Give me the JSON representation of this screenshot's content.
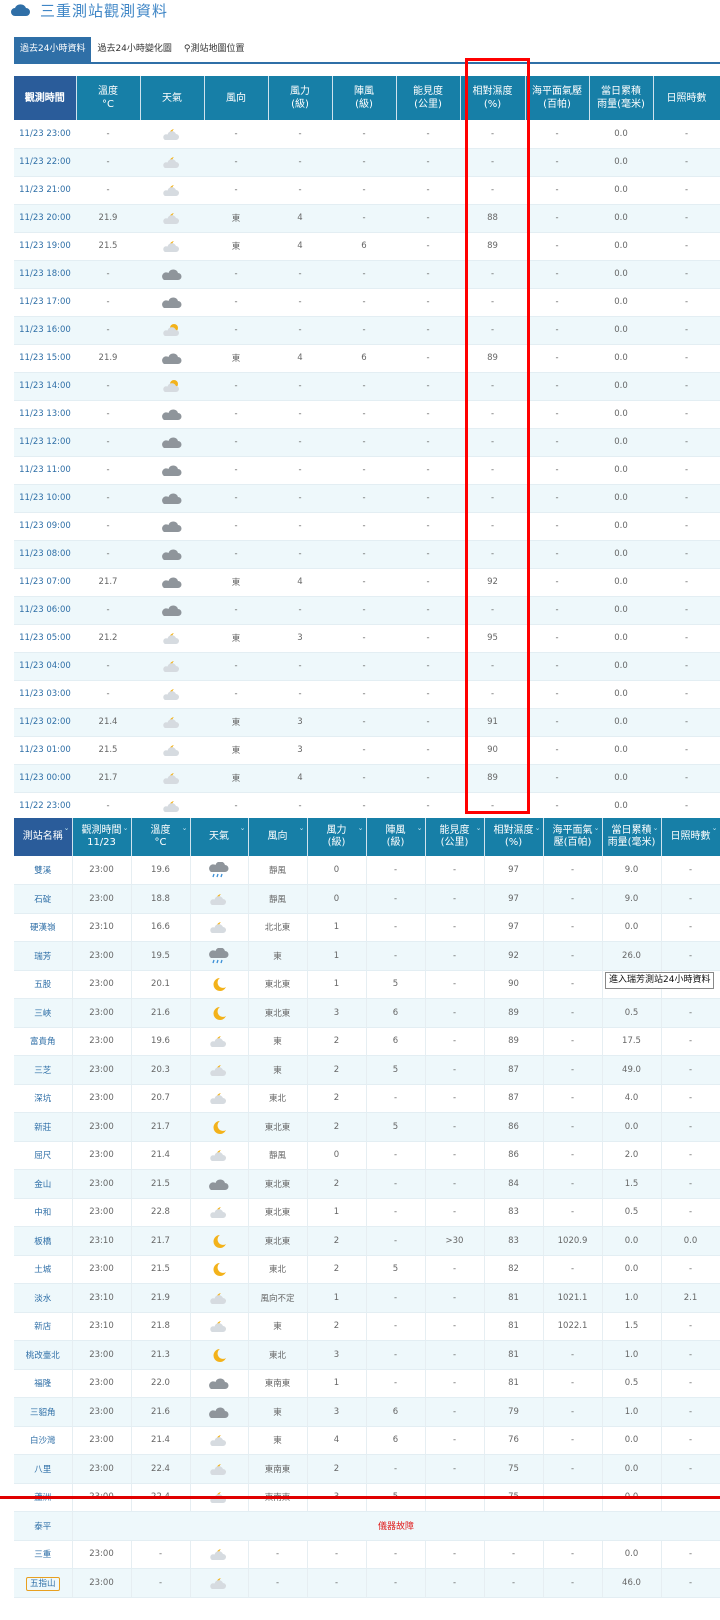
{
  "page": {
    "title": "三重測站觀測資料",
    "tabs": [
      "過去24小時資料",
      "過去24小時變化圖",
      "測站地圖位置"
    ]
  },
  "hourly": {
    "headers": [
      "觀測時間",
      "溫度\n°C",
      "天氣",
      "風向",
      "風力\n(級)",
      "陣風\n(級)",
      "能見度\n(公里)",
      "相對濕度\n(%)",
      "海平面氣壓\n(百帕)",
      "當日累積\n雨量(毫米)",
      "日照時數"
    ],
    "rows": [
      [
        "11/23 23:00",
        "-",
        "partly-cloudy-night",
        "-",
        "-",
        "-",
        "-",
        "-",
        "-",
        "0.0",
        "-"
      ],
      [
        "11/23 22:00",
        "-",
        "partly-cloudy-night",
        "-",
        "-",
        "-",
        "-",
        "-",
        "-",
        "0.0",
        "-"
      ],
      [
        "11/23 21:00",
        "-",
        "partly-cloudy-night",
        "-",
        "-",
        "-",
        "-",
        "-",
        "-",
        "0.0",
        "-"
      ],
      [
        "11/23 20:00",
        "21.9",
        "partly-cloudy-night",
        "東",
        "4",
        "-",
        "-",
        "88",
        "-",
        "0.0",
        "-"
      ],
      [
        "11/23 19:00",
        "21.5",
        "partly-cloudy-night",
        "東",
        "4",
        "6",
        "-",
        "89",
        "-",
        "0.0",
        "-"
      ],
      [
        "11/23 18:00",
        "-",
        "cloudy",
        "-",
        "-",
        "-",
        "-",
        "-",
        "-",
        "0.0",
        "-"
      ],
      [
        "11/23 17:00",
        "-",
        "cloudy",
        "-",
        "-",
        "-",
        "-",
        "-",
        "-",
        "0.0",
        "-"
      ],
      [
        "11/23 16:00",
        "-",
        "partly-cloudy-day",
        "-",
        "-",
        "-",
        "-",
        "-",
        "-",
        "0.0",
        "-"
      ],
      [
        "11/23 15:00",
        "21.9",
        "cloudy",
        "東",
        "4",
        "6",
        "-",
        "89",
        "-",
        "0.0",
        "-"
      ],
      [
        "11/23 14:00",
        "-",
        "partly-cloudy-day",
        "-",
        "-",
        "-",
        "-",
        "-",
        "-",
        "0.0",
        "-"
      ],
      [
        "11/23 13:00",
        "-",
        "cloudy",
        "-",
        "-",
        "-",
        "-",
        "-",
        "-",
        "0.0",
        "-"
      ],
      [
        "11/23 12:00",
        "-",
        "cloudy",
        "-",
        "-",
        "-",
        "-",
        "-",
        "-",
        "0.0",
        "-"
      ],
      [
        "11/23 11:00",
        "-",
        "cloudy",
        "-",
        "-",
        "-",
        "-",
        "-",
        "-",
        "0.0",
        "-"
      ],
      [
        "11/23 10:00",
        "-",
        "cloudy",
        "-",
        "-",
        "-",
        "-",
        "-",
        "-",
        "0.0",
        "-"
      ],
      [
        "11/23 09:00",
        "-",
        "cloudy",
        "-",
        "-",
        "-",
        "-",
        "-",
        "-",
        "0.0",
        "-"
      ],
      [
        "11/23 08:00",
        "-",
        "cloudy",
        "-",
        "-",
        "-",
        "-",
        "-",
        "-",
        "0.0",
        "-"
      ],
      [
        "11/23 07:00",
        "21.7",
        "cloudy",
        "東",
        "4",
        "-",
        "-",
        "92",
        "-",
        "0.0",
        "-"
      ],
      [
        "11/23 06:00",
        "-",
        "cloudy",
        "-",
        "-",
        "-",
        "-",
        "-",
        "-",
        "0.0",
        "-"
      ],
      [
        "11/23 05:00",
        "21.2",
        "partly-cloudy-night",
        "東",
        "3",
        "-",
        "-",
        "95",
        "-",
        "0.0",
        "-"
      ],
      [
        "11/23 04:00",
        "-",
        "partly-cloudy-night",
        "-",
        "-",
        "-",
        "-",
        "-",
        "-",
        "0.0",
        "-"
      ],
      [
        "11/23 03:00",
        "-",
        "partly-cloudy-night",
        "-",
        "-",
        "-",
        "-",
        "-",
        "-",
        "0.0",
        "-"
      ],
      [
        "11/23 02:00",
        "21.4",
        "partly-cloudy-night",
        "東",
        "3",
        "-",
        "-",
        "91",
        "-",
        "0.0",
        "-"
      ],
      [
        "11/23 01:00",
        "21.5",
        "partly-cloudy-night",
        "東",
        "3",
        "-",
        "-",
        "90",
        "-",
        "0.0",
        "-"
      ],
      [
        "11/23 00:00",
        "21.7",
        "partly-cloudy-night",
        "東",
        "4",
        "-",
        "-",
        "89",
        "-",
        "0.0",
        "-"
      ],
      [
        "11/22 23:00",
        "-",
        "partly-cloudy-night",
        "-",
        "-",
        "-",
        "-",
        "-",
        "-",
        "0.0",
        "-"
      ]
    ]
  },
  "stations": {
    "headers": [
      "測站名稱",
      "觀測時間\n11/23",
      "溫度\n°C",
      "天氣",
      "風向",
      "風力\n(級)",
      "陣風\n(級)",
      "能見度\n(公里)",
      "相對濕度\n(%)",
      "海平面氣\n壓(百帕)",
      "當日累積\n雨量(毫米)",
      "日照時數"
    ],
    "rows": [
      [
        "雙溪",
        "23:00",
        "19.6",
        "rain",
        "靜風",
        "0",
        "-",
        "-",
        "97",
        "-",
        "9.0",
        "-"
      ],
      [
        "石碇",
        "23:00",
        "18.8",
        "partly-cloudy-night",
        "靜風",
        "0",
        "-",
        "-",
        "97",
        "-",
        "9.0",
        "-"
      ],
      [
        "硬漢嶺",
        "23:10",
        "16.6",
        "partly-cloudy-night",
        "北北東",
        "1",
        "-",
        "-",
        "97",
        "-",
        "0.0",
        "-"
      ],
      [
        "瑞芳",
        "23:00",
        "19.5",
        "rain",
        "東",
        "1",
        "-",
        "-",
        "92",
        "-",
        "26.0",
        "-"
      ],
      [
        "五股",
        "23:00",
        "20.1",
        "moon",
        "東北東",
        "1",
        "5",
        "-",
        "90",
        "-",
        "",
        ""
      ],
      [
        "三峽",
        "23:00",
        "21.6",
        "moon",
        "東北東",
        "3",
        "6",
        "-",
        "89",
        "-",
        "0.5",
        "-"
      ],
      [
        "富貴角",
        "23:00",
        "19.6",
        "partly-cloudy-night",
        "東",
        "2",
        "6",
        "-",
        "89",
        "-",
        "17.5",
        "-"
      ],
      [
        "三芝",
        "23:00",
        "20.3",
        "partly-cloudy-night",
        "東",
        "2",
        "5",
        "-",
        "87",
        "-",
        "49.0",
        "-"
      ],
      [
        "深坑",
        "23:00",
        "20.7",
        "partly-cloudy-night",
        "東北",
        "2",
        "-",
        "-",
        "87",
        "-",
        "4.0",
        "-"
      ],
      [
        "新莊",
        "23:00",
        "21.7",
        "moon",
        "東北東",
        "2",
        "5",
        "-",
        "86",
        "-",
        "0.0",
        "-"
      ],
      [
        "屈尺",
        "23:00",
        "21.4",
        "partly-cloudy-night",
        "靜風",
        "0",
        "-",
        "-",
        "86",
        "-",
        "2.0",
        "-"
      ],
      [
        "金山",
        "23:00",
        "21.5",
        "cloudy",
        "東北東",
        "2",
        "-",
        "-",
        "84",
        "-",
        "1.5",
        "-"
      ],
      [
        "中和",
        "23:00",
        "22.8",
        "partly-cloudy-night",
        "東北東",
        "1",
        "-",
        "-",
        "83",
        "-",
        "0.5",
        "-"
      ],
      [
        "板橋",
        "23:10",
        "21.7",
        "moon",
        "東北東",
        "2",
        "-",
        ">30",
        "83",
        "1020.9",
        "0.0",
        "0.0"
      ],
      [
        "土城",
        "23:00",
        "21.5",
        "moon",
        "東北",
        "2",
        "5",
        "-",
        "82",
        "-",
        "0.0",
        "-"
      ],
      [
        "淡水",
        "23:10",
        "21.9",
        "partly-cloudy-night",
        "風向不定",
        "1",
        "-",
        "-",
        "81",
        "1021.1",
        "1.0",
        "2.1"
      ],
      [
        "新店",
        "23:10",
        "21.8",
        "partly-cloudy-night",
        "東",
        "2",
        "-",
        "-",
        "81",
        "1022.1",
        "1.5",
        "-"
      ],
      [
        "桃改臺北",
        "23:00",
        "21.3",
        "moon",
        "東北",
        "3",
        "-",
        "-",
        "81",
        "-",
        "1.0",
        "-"
      ],
      [
        "福隆",
        "23:00",
        "22.0",
        "cloudy",
        "東南東",
        "1",
        "-",
        "-",
        "81",
        "-",
        "0.5",
        "-"
      ],
      [
        "三貂角",
        "23:00",
        "21.6",
        "cloudy",
        "東",
        "3",
        "6",
        "-",
        "79",
        "-",
        "1.0",
        "-"
      ],
      [
        "白沙灣",
        "23:00",
        "21.4",
        "partly-cloudy-night",
        "東",
        "4",
        "6",
        "-",
        "76",
        "-",
        "0.0",
        "-"
      ],
      [
        "八里",
        "23:00",
        "22.4",
        "partly-cloudy-night",
        "東南東",
        "2",
        "-",
        "-",
        "75",
        "-",
        "0.0",
        "-"
      ],
      [
        "蘆洲",
        "23:00",
        "22.4",
        "partly-cloudy-night",
        "東南東",
        "3",
        "5",
        "-",
        "75",
        "-",
        "0.0",
        "-"
      ]
    ],
    "broken_station": "泰平",
    "broken_text": "儀器故障",
    "tail_rows": [
      [
        "三重",
        "23:00",
        "-",
        "partly-cloudy-night",
        "-",
        "-",
        "-",
        "-",
        "-",
        "-",
        "0.0",
        "-"
      ],
      [
        "五指山",
        "23:00",
        "-",
        "partly-cloudy-night",
        "-",
        "-",
        "-",
        "-",
        "-",
        "-",
        "46.0",
        "-"
      ]
    ]
  },
  "tooltip": "進入瑞芳測站24小時資料",
  "colors": {
    "header_bg": "#177fa7",
    "header_first_bg": "#2a5c9a",
    "link": "#2f6fa7",
    "highlight_box": "#ff0000",
    "error_text": "#e02020"
  }
}
